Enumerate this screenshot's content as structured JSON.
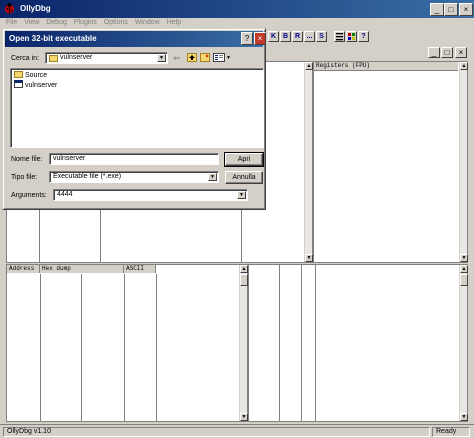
{
  "app": {
    "title": "OllyDbg",
    "menu": [
      "File",
      "View",
      "Debug",
      "Plugins",
      "Options",
      "Window",
      "Help"
    ],
    "toolbar_letters": [
      "K",
      "B",
      "R",
      "...",
      "S"
    ],
    "panes": {
      "registers_header": "Registers (FPU)",
      "dump_header_address": "Address",
      "dump_header_hex": "Hex dump",
      "dump_header_ascii": "ASCII"
    },
    "status": {
      "left": "OllyDbg v1.10",
      "right": "Ready"
    }
  },
  "dialog": {
    "title": "Open 32-bit executable",
    "look_in_label": "Cerca in:",
    "look_in_value": "vulnserver",
    "files": [
      {
        "name": "Source",
        "kind": "folder"
      },
      {
        "name": "vulnserver",
        "kind": "exe"
      }
    ],
    "filename_label": "Nome file:",
    "filename_value": "vulnserver",
    "filetype_label": "Tipo file:",
    "filetype_value": "Executable file (*.exe)",
    "arguments_label": "Arguments:",
    "arguments_value": "4444",
    "open_button": "Apri",
    "cancel_button": "Annulla",
    "help_button": "?",
    "close_button": "×"
  },
  "icons": {
    "app": "ladybug-icon",
    "back": "back-arrow-icon",
    "up": "up-folder-icon",
    "new_folder": "new-folder-icon",
    "views": "view-menu-icon"
  }
}
